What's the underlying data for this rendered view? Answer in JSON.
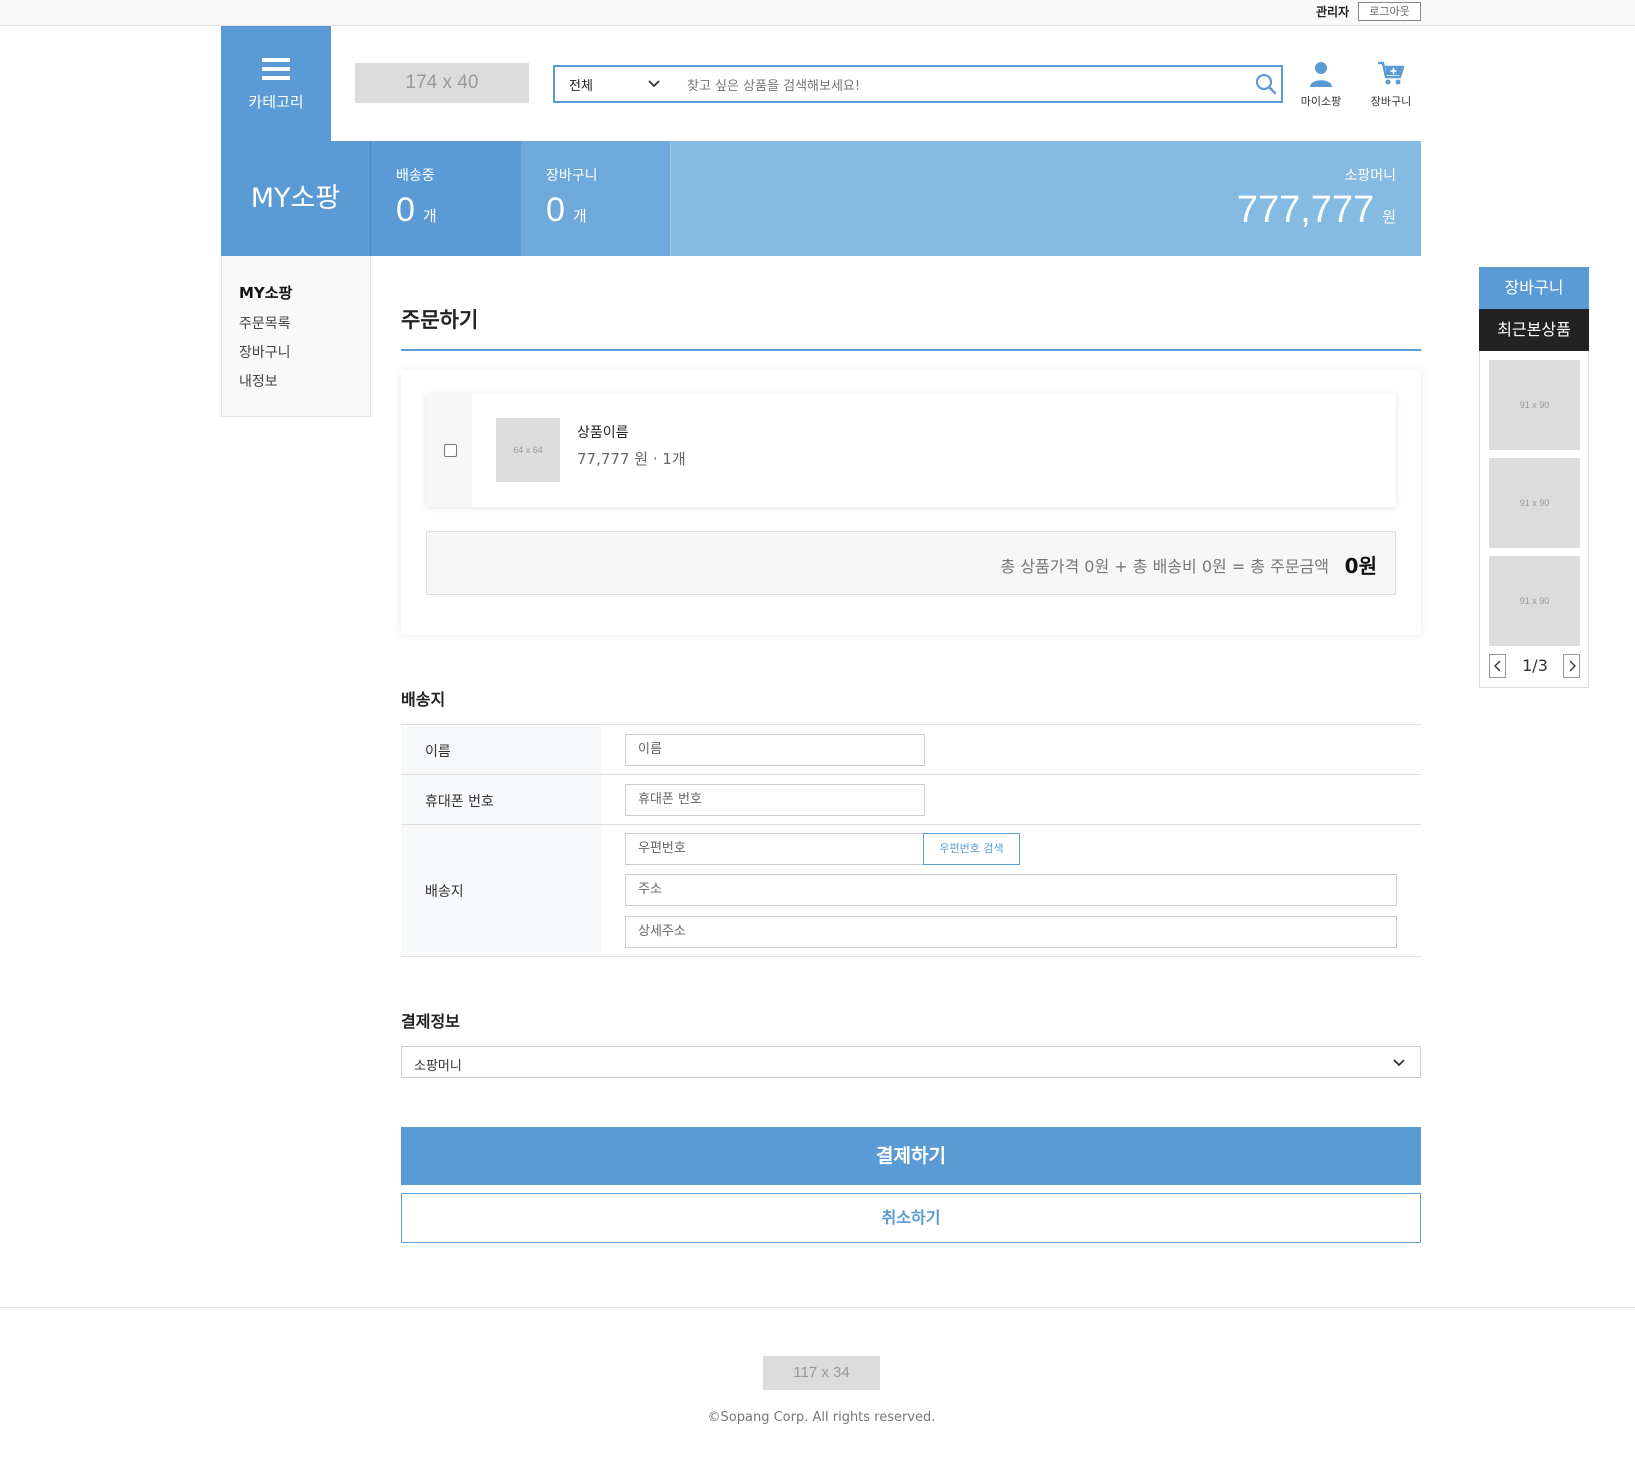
{
  "topbar": {
    "admin": "관리자",
    "logout": "로그아웃"
  },
  "header": {
    "category_label": "카테고리",
    "logo_placeholder": "174 x 40",
    "search_category": "전체",
    "search_placeholder": "찾고 싶은 상품을 검색해보세요!",
    "mypage_label": "마이소팡",
    "cart_label": "장바구니"
  },
  "banner": {
    "title": "MY소팡",
    "shipping": {
      "label": "배송중",
      "value": "0",
      "unit": "개"
    },
    "cart": {
      "label": "장바구니",
      "value": "0",
      "unit": "개"
    },
    "money": {
      "label": "소팡머니",
      "value": "777,777",
      "unit": "원"
    }
  },
  "sidemenu": {
    "title": "MY소팡",
    "items": [
      "주문목록",
      "장바구니",
      "내정보"
    ]
  },
  "order": {
    "title": "주문하기",
    "item": {
      "thumb": "64 x 64",
      "name": "상품이름",
      "price": "77,777 원 · 1개",
      "checked": false
    },
    "summary_text": "총 상품가격 0원 + 총 배송비 0원 = 총 주문금액",
    "summary_amount": "0원"
  },
  "shipping": {
    "title": "배송지",
    "name_label": "이름",
    "name_placeholder": "이름",
    "phone_label": "휴대폰 번호",
    "phone_placeholder": "휴대폰 번호",
    "address_label": "배송지",
    "zip_placeholder": "우편번호",
    "zip_button": "우편번호 검색",
    "address_placeholder": "주소",
    "detail_placeholder": "상세주소"
  },
  "payment": {
    "title": "결제정보",
    "selected": "소팡머니",
    "pay_button": "결제하기",
    "cancel_button": "취소하기"
  },
  "rpanel": {
    "cart": "장바구니",
    "recent": "최근본상품",
    "thumbs": [
      "91 x 90",
      "91 x 90",
      "91 x 90"
    ],
    "page": "1/3"
  },
  "footer": {
    "logo_placeholder": "117 x 34",
    "copyright": "©Sopang Corp. All rights reserved."
  },
  "colors": {
    "accent": "#5b9bd5",
    "banner_light": "#85bae3",
    "dark": "#222222"
  }
}
